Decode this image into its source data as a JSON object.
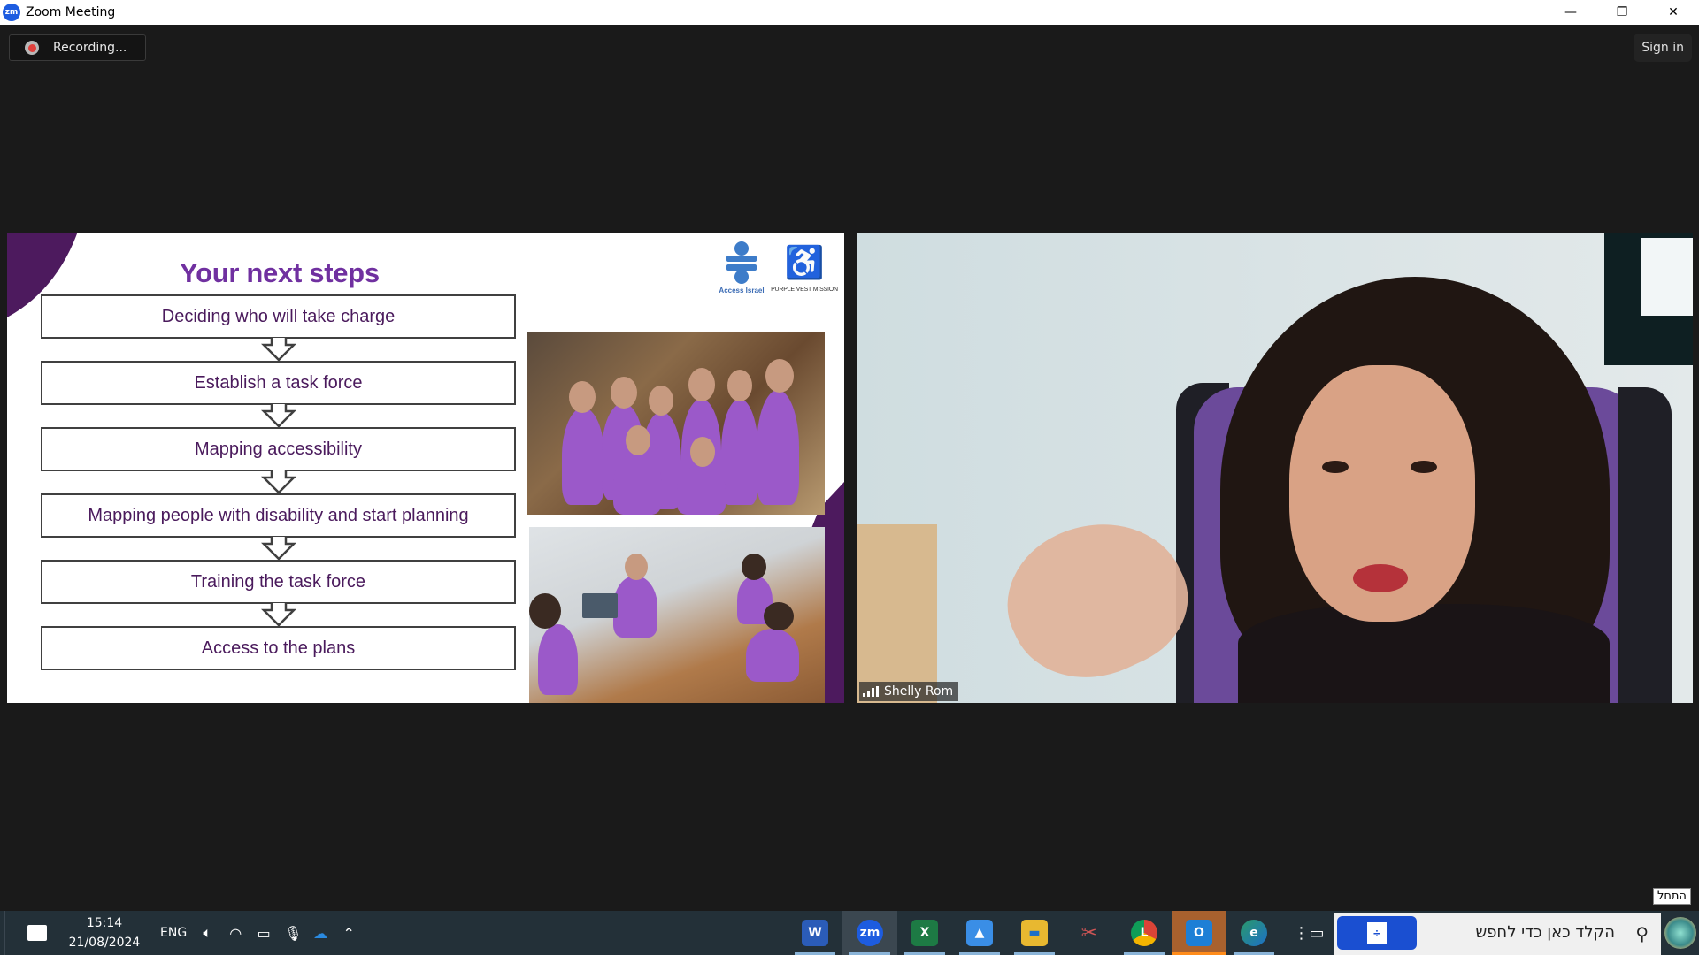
{
  "window": {
    "app_icon": "zoom-logo-icon",
    "app_icon_text": "zm",
    "title": "Zoom Meeting",
    "controls": {
      "minimize": "—",
      "restore": "❐",
      "close": "✕"
    }
  },
  "meeting": {
    "recording_label": "Recording...",
    "sign_in_label": "Sign in"
  },
  "slide": {
    "title": "Your next steps",
    "logos": [
      {
        "name": "access-israel-logo",
        "label": "Access Israel"
      },
      {
        "name": "purple-vest-mission-logo",
        "label": "PURPLE VEST MISSION"
      }
    ],
    "steps": [
      "Deciding who will take charge",
      "Establish a task force",
      "Mapping accessibility",
      "Mapping people with disability and start planning",
      "Training the task force",
      "Access to the plans"
    ],
    "accent_color": "#7030a0",
    "corner_color": "#4d1a5e"
  },
  "video": {
    "participant_name": "Shelly Rom"
  },
  "taskbar": {
    "time": "15:14",
    "date": "21/08/2024",
    "language": "ENG",
    "tray_icons": [
      "volume-icon",
      "wifi-icon",
      "battery-icon",
      "microphone-icon",
      "onedrive-icon",
      "chevron-up-icon"
    ],
    "apps": [
      {
        "name": "word",
        "label": "W",
        "color": "#2b5cb8",
        "active": false,
        "highlight": false
      },
      {
        "name": "zoom",
        "label": "zm",
        "color": "#1d5ce0",
        "active": true,
        "highlight": false
      },
      {
        "name": "excel",
        "label": "X",
        "color": "#1d7a44",
        "active": false,
        "highlight": false
      },
      {
        "name": "photos",
        "label": "▲",
        "color": "#3a8ee6",
        "active": false,
        "highlight": false
      },
      {
        "name": "file-explorer",
        "label": "▬",
        "color": "#e8b830",
        "active": false,
        "highlight": false
      },
      {
        "name": "snipping-tool",
        "label": "✂",
        "color": "#cf5555",
        "active": false,
        "highlight": false
      },
      {
        "name": "chrome",
        "label": "L",
        "color": "#e0a020",
        "active": false,
        "highlight": false
      },
      {
        "name": "outlook",
        "label": "O",
        "color": "#1d7fd6",
        "active": false,
        "highlight": true
      },
      {
        "name": "edge",
        "label": "e",
        "color": "#2a9a6a",
        "active": false,
        "highlight": false
      },
      {
        "name": "task-view",
        "label": "⋮▭",
        "color": "transparent",
        "active": false,
        "highlight": false
      }
    ],
    "search_placeholder": "הקלד כאן כדי לחפש",
    "start_tooltip": "התחל"
  }
}
